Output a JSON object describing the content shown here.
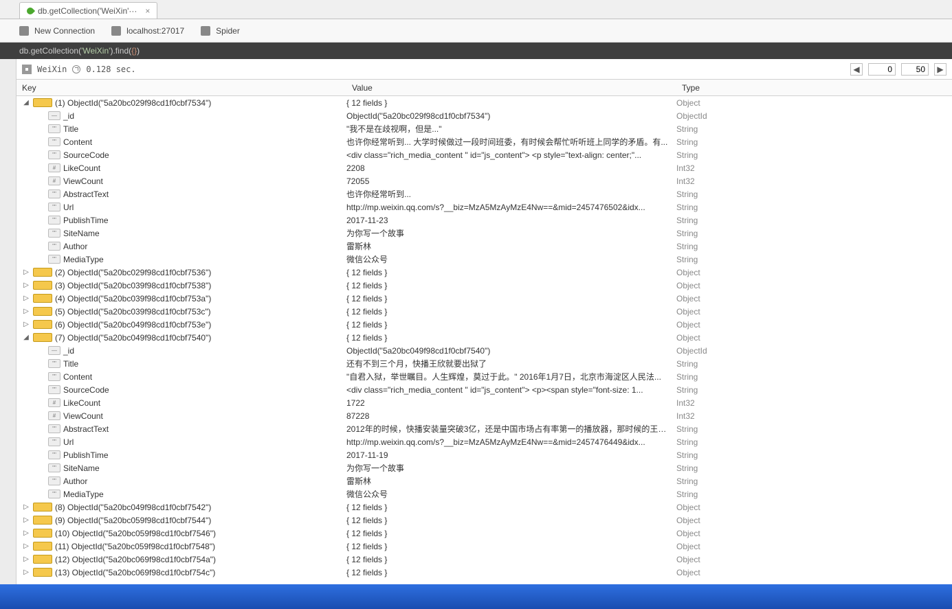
{
  "tab": {
    "title": "db.getCollection('WeiXin'···"
  },
  "toolbar": {
    "newconn": "New Connection",
    "host": "localhost:27017",
    "db": "Spider"
  },
  "query": {
    "prefix": "db.",
    "method1": "getCollection",
    "arg": "'WeiXin'",
    "method2": ".find",
    "braces": "{}"
  },
  "resultbar": {
    "collection": "WeiXin",
    "time": "0.128 sec.",
    "page_from": "0",
    "page_size": "50"
  },
  "headers": {
    "key": "Key",
    "value": "Value",
    "type": "Type"
  },
  "rows": [
    {
      "lvl": 0,
      "expanded": true,
      "icon": "obj",
      "key": "(1) ObjectId(\"5a20bc029f98cd1f0cbf7534\")",
      "value": "{ 12 fields }",
      "type": "Object"
    },
    {
      "lvl": 1,
      "icon": "id",
      "key": "_id",
      "value": "ObjectId(\"5a20bc029f98cd1f0cbf7534\")",
      "type": "ObjectId"
    },
    {
      "lvl": 1,
      "icon": "str",
      "key": "Title",
      "value": "\"我不是在歧视啊，但是...\"",
      "type": "String"
    },
    {
      "lvl": 1,
      "icon": "str",
      "key": "Content",
      "value": "也许你经常听到... 大学时候做过一段时间班委，有时候会帮忙听听班上同学的矛盾。有...",
      "type": "String"
    },
    {
      "lvl": 1,
      "icon": "str",
      "key": "SourceCode",
      "value": "<div class=\"rich_media_content \" id=\"js_content\"> <p style=\"text-align: center;\"...",
      "type": "String"
    },
    {
      "lvl": 1,
      "icon": "int",
      "key": "LikeCount",
      "value": "2208",
      "type": "Int32"
    },
    {
      "lvl": 1,
      "icon": "int",
      "key": "ViewCount",
      "value": "72055",
      "type": "Int32"
    },
    {
      "lvl": 1,
      "icon": "str",
      "key": "AbstractText",
      "value": "也许你经常听到...",
      "type": "String"
    },
    {
      "lvl": 1,
      "icon": "str",
      "key": "Url",
      "value": "http://mp.weixin.qq.com/s?__biz=MzA5MzAyMzE4Nw==&mid=2457476502&idx...",
      "type": "String"
    },
    {
      "lvl": 1,
      "icon": "str",
      "key": "PublishTime",
      "value": "2017-11-23",
      "type": "String"
    },
    {
      "lvl": 1,
      "icon": "str",
      "key": "SiteName",
      "value": "为你写一个故事",
      "type": "String"
    },
    {
      "lvl": 1,
      "icon": "str",
      "key": "Author",
      "value": "雷斯林",
      "type": "String"
    },
    {
      "lvl": 1,
      "icon": "str",
      "key": "MediaType",
      "value": "微信公众号",
      "type": "String"
    },
    {
      "lvl": 0,
      "expanded": false,
      "icon": "obj",
      "key": "(2) ObjectId(\"5a20bc029f98cd1f0cbf7536\")",
      "value": "{ 12 fields }",
      "type": "Object"
    },
    {
      "lvl": 0,
      "expanded": false,
      "icon": "obj",
      "key": "(3) ObjectId(\"5a20bc039f98cd1f0cbf7538\")",
      "value": "{ 12 fields }",
      "type": "Object"
    },
    {
      "lvl": 0,
      "expanded": false,
      "icon": "obj",
      "key": "(4) ObjectId(\"5a20bc039f98cd1f0cbf753a\")",
      "value": "{ 12 fields }",
      "type": "Object"
    },
    {
      "lvl": 0,
      "expanded": false,
      "icon": "obj",
      "key": "(5) ObjectId(\"5a20bc039f98cd1f0cbf753c\")",
      "value": "{ 12 fields }",
      "type": "Object"
    },
    {
      "lvl": 0,
      "expanded": false,
      "icon": "obj",
      "key": "(6) ObjectId(\"5a20bc049f98cd1f0cbf753e\")",
      "value": "{ 12 fields }",
      "type": "Object"
    },
    {
      "lvl": 0,
      "expanded": true,
      "icon": "obj",
      "key": "(7) ObjectId(\"5a20bc049f98cd1f0cbf7540\")",
      "value": "{ 12 fields }",
      "type": "Object"
    },
    {
      "lvl": 1,
      "icon": "id",
      "key": "_id",
      "value": "ObjectId(\"5a20bc049f98cd1f0cbf7540\")",
      "type": "ObjectId"
    },
    {
      "lvl": 1,
      "icon": "str",
      "key": "Title",
      "value": "还有不到三个月，快播王欣就要出狱了",
      "type": "String"
    },
    {
      "lvl": 1,
      "icon": "str",
      "key": "Content",
      "value": "\"自君入狱，举世瞩目。人生辉煌，莫过于此。\" 2016年1月7日，北京市海淀区人民法...",
      "type": "String"
    },
    {
      "lvl": 1,
      "icon": "str",
      "key": "SourceCode",
      "value": "<div class=\"rich_media_content \" id=\"js_content\"> <p><span style=\"font-size: 1...",
      "type": "String"
    },
    {
      "lvl": 1,
      "icon": "int",
      "key": "LikeCount",
      "value": "1722",
      "type": "Int32"
    },
    {
      "lvl": 1,
      "icon": "int",
      "key": "ViewCount",
      "value": "87228",
      "type": "Int32"
    },
    {
      "lvl": 1,
      "icon": "str",
      "key": "AbstractText",
      "value": "2012年的时候，快播安装量突破3亿，还是中国市场占有率第一的播放器，那时候的王欣...",
      "type": "String"
    },
    {
      "lvl": 1,
      "icon": "str",
      "key": "Url",
      "value": "http://mp.weixin.qq.com/s?__biz=MzA5MzAyMzE4Nw==&mid=2457476449&idx...",
      "type": "String"
    },
    {
      "lvl": 1,
      "icon": "str",
      "key": "PublishTime",
      "value": "2017-11-19",
      "type": "String"
    },
    {
      "lvl": 1,
      "icon": "str",
      "key": "SiteName",
      "value": "为你写一个故事",
      "type": "String"
    },
    {
      "lvl": 1,
      "icon": "str",
      "key": "Author",
      "value": "雷斯林",
      "type": "String"
    },
    {
      "lvl": 1,
      "icon": "str",
      "key": "MediaType",
      "value": "微信公众号",
      "type": "String"
    },
    {
      "lvl": 0,
      "expanded": false,
      "icon": "obj",
      "key": "(8) ObjectId(\"5a20bc049f98cd1f0cbf7542\")",
      "value": "{ 12 fields }",
      "type": "Object"
    },
    {
      "lvl": 0,
      "expanded": false,
      "icon": "obj",
      "key": "(9) ObjectId(\"5a20bc059f98cd1f0cbf7544\")",
      "value": "{ 12 fields }",
      "type": "Object"
    },
    {
      "lvl": 0,
      "expanded": false,
      "icon": "obj",
      "key": "(10) ObjectId(\"5a20bc059f98cd1f0cbf7546\")",
      "value": "{ 12 fields }",
      "type": "Object"
    },
    {
      "lvl": 0,
      "expanded": false,
      "icon": "obj",
      "key": "(11) ObjectId(\"5a20bc059f98cd1f0cbf7548\")",
      "value": "{ 12 fields }",
      "type": "Object"
    },
    {
      "lvl": 0,
      "expanded": false,
      "icon": "obj",
      "key": "(12) ObjectId(\"5a20bc069f98cd1f0cbf754a\")",
      "value": "{ 12 fields }",
      "type": "Object"
    },
    {
      "lvl": 0,
      "expanded": false,
      "icon": "obj",
      "key": "(13) ObjectId(\"5a20bc069f98cd1f0cbf754c\")",
      "value": "{ 12 fields }",
      "type": "Object"
    }
  ]
}
